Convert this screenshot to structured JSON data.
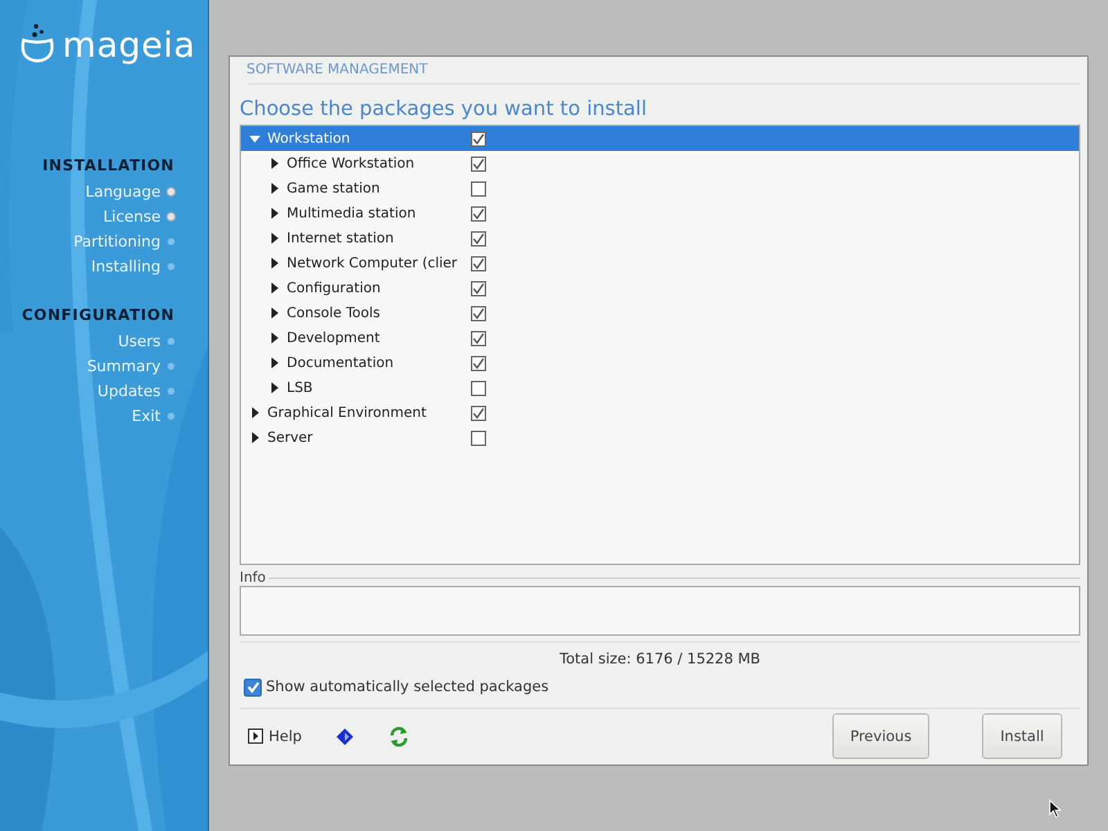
{
  "logo": {
    "text": "mageia"
  },
  "sidebar": {
    "sections": [
      {
        "title": "INSTALLATION",
        "steps": [
          {
            "label": "Language",
            "done": true
          },
          {
            "label": "License",
            "done": true
          },
          {
            "label": "Partitioning",
            "done": false
          },
          {
            "label": "Installing",
            "done": false
          }
        ]
      },
      {
        "title": "CONFIGURATION",
        "steps": [
          {
            "label": "Users",
            "done": false
          },
          {
            "label": "Summary",
            "done": false
          },
          {
            "label": "Updates",
            "done": false
          },
          {
            "label": "Exit",
            "done": false
          }
        ]
      }
    ]
  },
  "dialog": {
    "section_title": "SOFTWARE MANAGEMENT",
    "heading": "Choose the packages you want to install",
    "tree": [
      {
        "label": "Workstation",
        "checked": true,
        "expanded": true,
        "selected": true,
        "children": [
          {
            "label": "Office Workstation",
            "checked": true,
            "expanded": false,
            "selected": false
          },
          {
            "label": "Game station",
            "checked": false,
            "expanded": false,
            "selected": false
          },
          {
            "label": "Multimedia station",
            "checked": true,
            "expanded": false,
            "selected": false
          },
          {
            "label": "Internet station",
            "checked": true,
            "expanded": false,
            "selected": false
          },
          {
            "label": "Network Computer (clier",
            "checked": true,
            "expanded": false,
            "selected": false
          },
          {
            "label": "Configuration",
            "checked": true,
            "expanded": false,
            "selected": false
          },
          {
            "label": "Console Tools",
            "checked": true,
            "expanded": false,
            "selected": false
          },
          {
            "label": "Development",
            "checked": true,
            "expanded": false,
            "selected": false
          },
          {
            "label": "Documentation",
            "checked": true,
            "expanded": false,
            "selected": false
          },
          {
            "label": "LSB",
            "checked": false,
            "expanded": false,
            "selected": false
          }
        ]
      },
      {
        "label": "Graphical Environment",
        "checked": true,
        "expanded": false,
        "selected": false
      },
      {
        "label": "Server",
        "checked": false,
        "expanded": false,
        "selected": false
      }
    ],
    "info_label": "Info",
    "total_size": "Total size: 6176 / 15228 MB",
    "show_auto": {
      "label": "Show automatically selected packages",
      "checked": true
    },
    "help": "Help",
    "buttons": [
      "Previous",
      "Install"
    ]
  }
}
